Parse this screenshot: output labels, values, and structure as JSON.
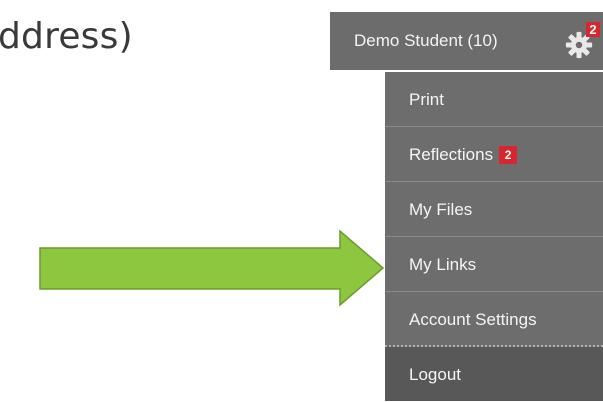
{
  "background_text": "ddress)",
  "user_menu": {
    "user_label": "Demo Student (10)",
    "gear_badge": "2",
    "gear_icon": "gear-icon"
  },
  "menu": {
    "items": [
      {
        "label": "Print",
        "badge": null
      },
      {
        "label": "Reflections",
        "badge": "2"
      },
      {
        "label": "My Files",
        "badge": null
      },
      {
        "label": "My Links",
        "badge": null
      },
      {
        "label": "Account Settings",
        "badge": null
      },
      {
        "label": "Logout",
        "badge": null
      }
    ]
  },
  "annotation": {
    "arrow_color": "#8dc63f",
    "arrow_border_color": "#6e9a2e",
    "points_to": "My Links"
  },
  "colors": {
    "menu_bg": "#6d6d6d",
    "logout_bg": "#585858",
    "badge": "#d7262e"
  }
}
